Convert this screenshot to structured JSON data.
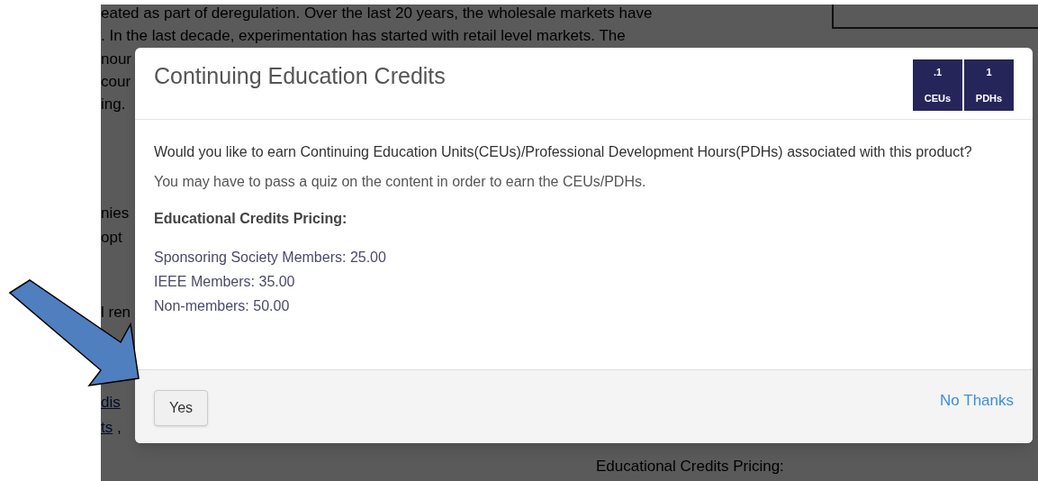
{
  "background": {
    "lines": [
      {
        "segments": [
          {
            "kind": "text",
            "text": "eated as part of deregulation. Over the last 20 years, the wholesale markets have"
          }
        ]
      },
      {
        "segments": [
          {
            "kind": "text",
            "text": ". In the last decade, experimentation has started with retail level markets. The"
          }
        ]
      },
      {
        "segments": [
          {
            "kind": "text",
            "text": "nour"
          }
        ]
      },
      {
        "segments": [
          {
            "kind": "text",
            "text": "cour"
          }
        ]
      },
      {
        "segments": [
          {
            "kind": "text",
            "text": "ing."
          }
        ]
      },
      {
        "segments": [
          {
            "kind": "text",
            "text": "nies"
          }
        ]
      },
      {
        "segments": [
          {
            "kind": "text",
            "text": "opt"
          }
        ]
      },
      {
        "segments": [
          {
            "kind": "text",
            "text": "l ren"
          }
        ]
      },
      {
        "segments": [
          {
            "kind": "link",
            "text": "dis"
          }
        ]
      },
      {
        "segments": [
          {
            "kind": "link",
            "text": "ts"
          },
          {
            "kind": "text",
            "text": " ,"
          }
        ]
      }
    ],
    "footer_heading": "Educational Credits Pricing:"
  },
  "modal": {
    "title": "Continuing Education Credits",
    "badges": [
      {
        "value": ".1",
        "unit": "CEUs"
      },
      {
        "value": "1",
        "unit": "PDHs"
      }
    ],
    "question": "Would you like to earn Continuing Education Units(CEUs)/Professional Development Hours(PDHs) associated with this product?",
    "note": "You may have to pass a quiz on the content in order to earn the CEUs/PDHs.",
    "pricing_heading": "Educational Credits Pricing:",
    "prices": [
      "Sponsoring Society Members: 25.00",
      "IEEE Members: 35.00",
      "Non-members: 50.00"
    ],
    "buttons": {
      "confirm": "Yes",
      "decline": "No Thanks"
    }
  }
}
